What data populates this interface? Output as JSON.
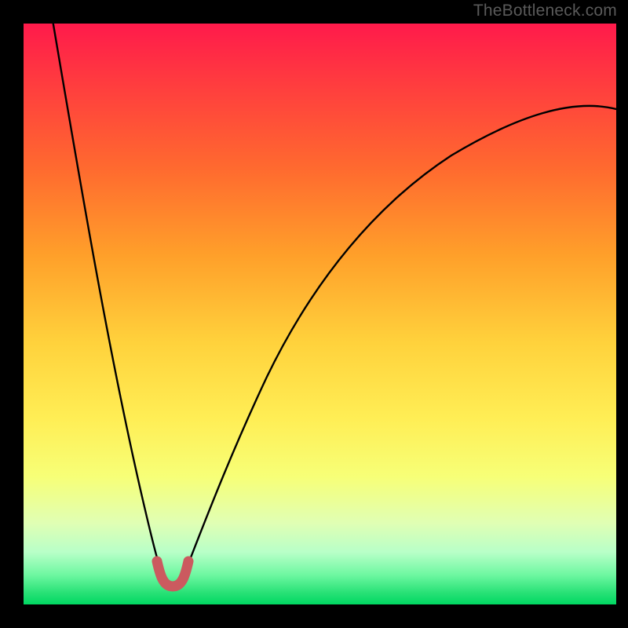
{
  "watermark": "TheBottleneck.com",
  "chart_data": {
    "type": "line",
    "title": "",
    "xlabel": "",
    "ylabel": "",
    "xlim": [
      0,
      100
    ],
    "ylim": [
      0,
      100
    ],
    "grid": false,
    "legend": false,
    "series": [
      {
        "name": "bottleneck-curve",
        "x": [
          5,
          8,
          11,
          14,
          17,
          20,
          22,
          23,
          24,
          25,
          26,
          28,
          31,
          35,
          40,
          46,
          53,
          61,
          70,
          80,
          90,
          100
        ],
        "y": [
          100,
          85,
          70,
          55,
          40,
          25,
          12,
          5,
          1,
          0,
          1,
          6,
          16,
          28,
          40,
          50,
          58,
          66,
          73,
          78,
          82,
          85
        ]
      },
      {
        "name": "highlight-segment",
        "x": [
          22.2,
          22.8,
          23.6,
          24.6,
          25.6,
          26.4,
          27.2,
          27.8
        ],
        "y": [
          5.5,
          2.7,
          1.0,
          0.3,
          0.3,
          1.0,
          2.7,
          5.5
        ]
      }
    ],
    "minimum": {
      "x": 25,
      "y": 0
    },
    "background_gradient": {
      "top": "#ff1a4b",
      "mid": "#ffd23c",
      "bottom": "#00d862"
    },
    "colors": {
      "curve": "#000000",
      "highlight": "#cb5a5f"
    }
  }
}
